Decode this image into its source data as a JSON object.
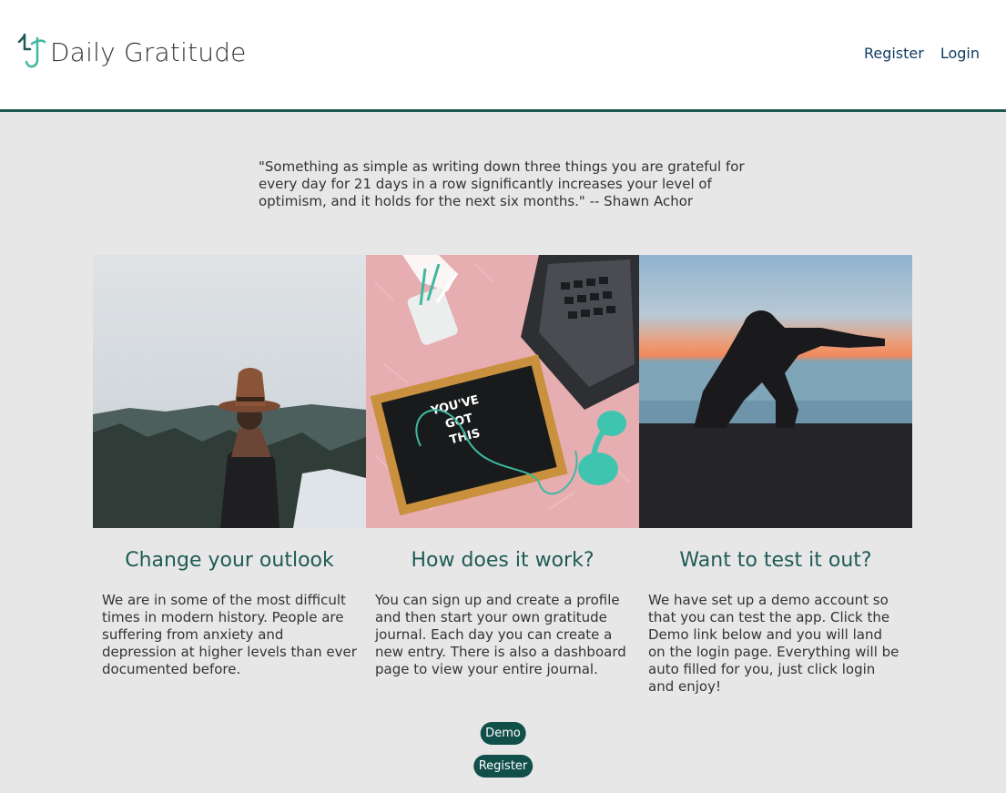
{
  "header": {
    "brand": "Daily Gratitude",
    "nav": {
      "register": "Register",
      "login": "Login"
    }
  },
  "quote": "\"Something as simple as writing down three things you are grateful for every day for 21 days in a row significantly increases your level of optimism, and it holds for the next six months.\" -- Shawn Achor",
  "columns": [
    {
      "title": "Change your outlook",
      "text": "We are in some of the most difficult times in modern history. People are suffering from anxiety and depression at higher levels than ever documented before."
    },
    {
      "title": "How does it work?",
      "text": "You can sign up and create a profile and then start your own gratitude journal. Each day you can create a new entry. There is also a dashboard page to view your entire journal."
    },
    {
      "title": "Want to test it out?",
      "text": "We have set up a demo account so that you can test the app. Click the Demo link below and you will land on the login page. Everything will be auto filled for you, just click login and enjoy!"
    }
  ],
  "images": {
    "letterboard": "YOU'VE\nGOT\nTHIS"
  },
  "buttons": {
    "demo": "Demo",
    "register": "Register"
  },
  "colors": {
    "accent": "#1e5b55",
    "button": "#114f4b",
    "nav": "#123d63",
    "logo": "#3fb8a0"
  }
}
